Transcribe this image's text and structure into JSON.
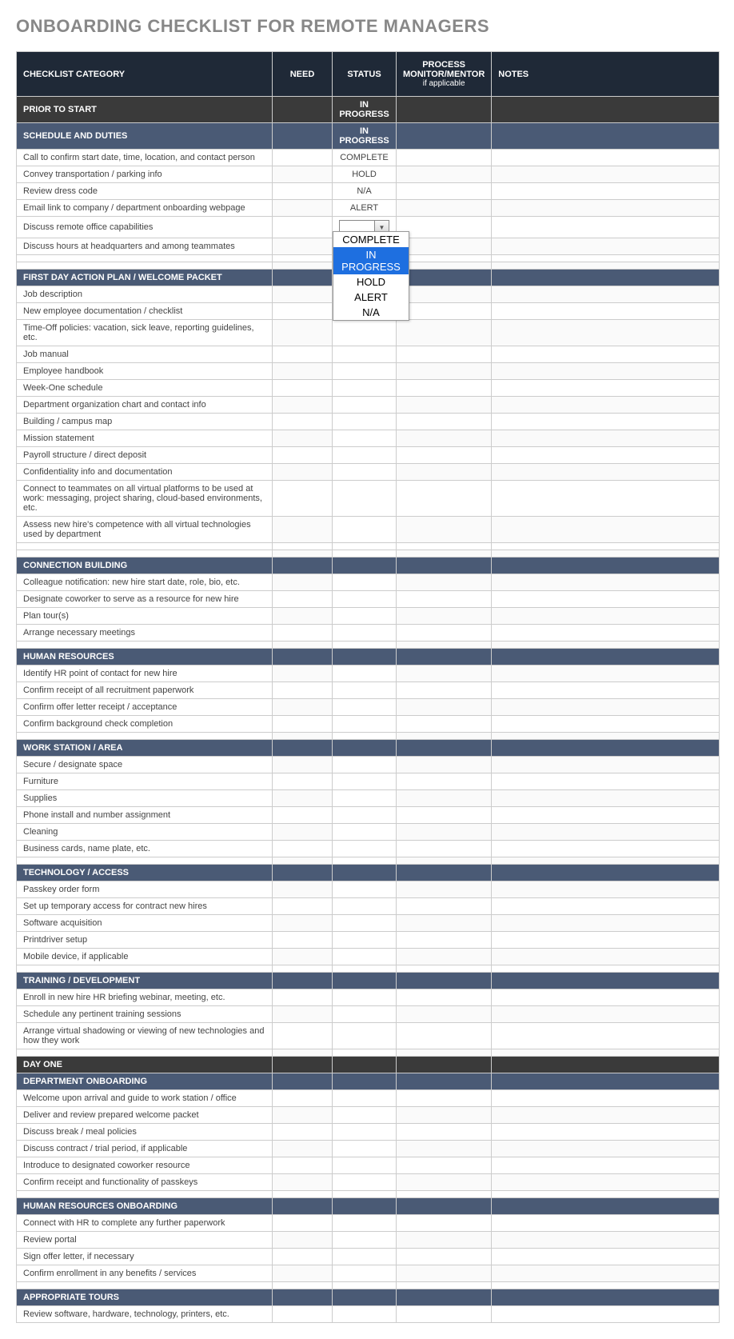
{
  "title": "ONBOARDING CHECKLIST FOR REMOTE MANAGERS",
  "columns": {
    "category": "CHECKLIST CATEGORY",
    "need": "NEED",
    "status": "STATUS",
    "pm": "PROCESS MONITOR/MENTOR",
    "pm_sub": "if applicable",
    "notes": "NOTES"
  },
  "dropdown": {
    "options": [
      "COMPLETE",
      "IN PROGRESS",
      "HOLD",
      "ALERT",
      "N/A"
    ],
    "selected": "IN PROGRESS"
  },
  "phases": [
    {
      "name": "PRIOR TO START",
      "status": "IN PROGRESS",
      "sections": [
        {
          "name": "SCHEDULE AND DUTIES",
          "status": "IN PROGRESS",
          "items": [
            {
              "label": "Call to confirm start date, time, location, and contact person",
              "status": "COMPLETE"
            },
            {
              "label": "Convey transportation / parking info",
              "status": "HOLD"
            },
            {
              "label": "Review dress code",
              "status": "N/A"
            },
            {
              "label": "Email link to company / department onboarding webpage",
              "status": "ALERT"
            },
            {
              "label": "Discuss remote office capabilities",
              "status": "",
              "dropdown": true
            },
            {
              "label": "Discuss hours at headquarters and among teammates",
              "status": ""
            },
            {
              "label": "",
              "status": ""
            },
            {
              "label": "",
              "status": ""
            }
          ]
        },
        {
          "name": "FIRST DAY ACTION PLAN / WELCOME PACKET",
          "items": [
            {
              "label": "Job description"
            },
            {
              "label": "New employee documentation / checklist"
            },
            {
              "label": "Time-Off policies: vacation, sick leave, reporting guidelines, etc."
            },
            {
              "label": "Job manual"
            },
            {
              "label": "Employee handbook"
            },
            {
              "label": "Week-One schedule"
            },
            {
              "label": "Department organization chart and contact info"
            },
            {
              "label": "Building / campus map"
            },
            {
              "label": "Mission statement"
            },
            {
              "label": "Payroll structure / direct deposit"
            },
            {
              "label": "Confidentiality info and documentation"
            },
            {
              "label": "Connect to teammates on all virtual platforms to be used at work: messaging, project sharing, cloud-based environments, etc."
            },
            {
              "label": "Assess new hire's competence with all virtual technologies used by department"
            },
            {
              "label": ""
            },
            {
              "label": ""
            }
          ]
        },
        {
          "name": "CONNECTION BUILDING",
          "items": [
            {
              "label": "Colleague notification: new hire start date, role, bio, etc."
            },
            {
              "label": "Designate coworker to serve as a resource for new hire"
            },
            {
              "label": "Plan tour(s)"
            },
            {
              "label": "Arrange necessary meetings"
            },
            {
              "label": ""
            }
          ]
        },
        {
          "name": "HUMAN RESOURCES",
          "items": [
            {
              "label": "Identify HR point of contact for new hire"
            },
            {
              "label": "Confirm receipt of all recruitment paperwork"
            },
            {
              "label": "Confirm offer letter receipt / acceptance"
            },
            {
              "label": "Confirm background check completion"
            },
            {
              "label": ""
            }
          ]
        },
        {
          "name": "WORK STATION / AREA",
          "items": [
            {
              "label": "Secure / designate space"
            },
            {
              "label": "Furniture"
            },
            {
              "label": "Supplies"
            },
            {
              "label": "Phone install and number assignment"
            },
            {
              "label": "Cleaning"
            },
            {
              "label": "Business cards, name plate, etc."
            },
            {
              "label": ""
            }
          ]
        },
        {
          "name": "TECHNOLOGY / ACCESS",
          "items": [
            {
              "label": "Passkey order form"
            },
            {
              "label": "Set up temporary access for contract new hires"
            },
            {
              "label": "Software acquisition"
            },
            {
              "label": "Printdriver setup"
            },
            {
              "label": "Mobile device, if applicable"
            },
            {
              "label": ""
            }
          ]
        },
        {
          "name": "TRAINING / DEVELOPMENT",
          "items": [
            {
              "label": "Enroll in new hire HR briefing webinar, meeting, etc."
            },
            {
              "label": "Schedule any pertinent training sessions"
            },
            {
              "label": "Arrange virtual shadowing or viewing of new technologies and how they work"
            },
            {
              "label": ""
            }
          ]
        }
      ]
    },
    {
      "name": "DAY ONE",
      "status": "",
      "sections": [
        {
          "name": "DEPARTMENT ONBOARDING",
          "items": [
            {
              "label": "Welcome upon arrival and guide to work station / office"
            },
            {
              "label": "Deliver and review prepared welcome packet"
            },
            {
              "label": "Discuss break / meal policies"
            },
            {
              "label": "Discuss contract / trial period, if applicable"
            },
            {
              "label": "Introduce to designated coworker resource"
            },
            {
              "label": "Confirm receipt and functionality of passkeys"
            },
            {
              "label": ""
            }
          ]
        },
        {
          "name": "HUMAN RESOURCES ONBOARDING",
          "items": [
            {
              "label": "Connect with HR to complete any further paperwork"
            },
            {
              "label": "Review portal"
            },
            {
              "label": "Sign offer letter, if necessary"
            },
            {
              "label": "Confirm enrollment in any benefits / services"
            },
            {
              "label": ""
            }
          ]
        },
        {
          "name": "APPROPRIATE TOURS",
          "items": [
            {
              "label": "Review software, hardware, technology, printers, etc."
            }
          ]
        }
      ]
    }
  ]
}
